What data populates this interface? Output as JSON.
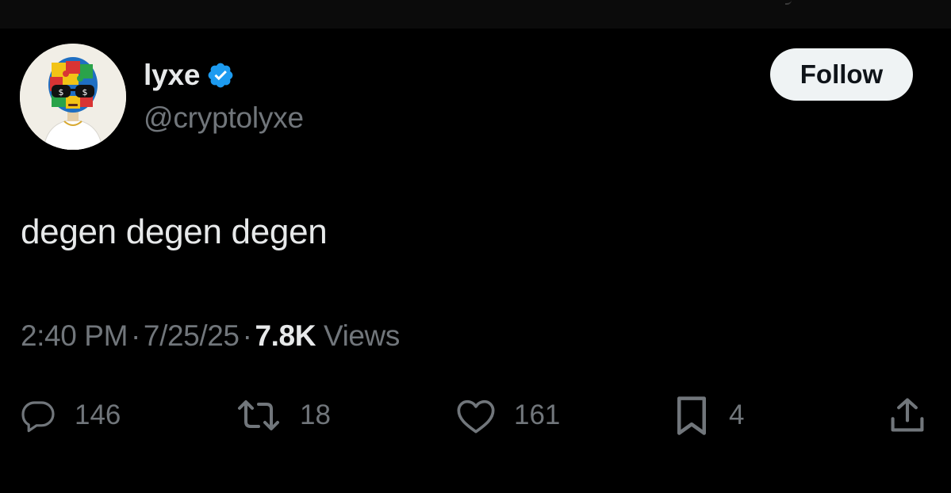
{
  "colors": {
    "background": "#000000",
    "primary_text": "#e7e9ea",
    "secondary_text": "#71767b",
    "verified_badge": "#1d9bf0",
    "follow_button_bg": "#eff3f4",
    "follow_button_text": "#0f1419"
  },
  "author": {
    "display_name": "lyxe",
    "handle": "@cryptolyxe",
    "verified": true,
    "verified_icon": "verified-badge-icon",
    "avatar_icon": "avatar"
  },
  "follow_button": {
    "label": "Follow"
  },
  "tweet": {
    "text": "degen degen degen"
  },
  "meta": {
    "time": "2:40 PM",
    "separator": "·",
    "date": "7/25/25",
    "views_count": "7.8K",
    "views_label": "Views"
  },
  "actions": {
    "reply": {
      "icon": "reply-icon",
      "count": "146"
    },
    "repost": {
      "icon": "repost-icon",
      "count": "18"
    },
    "like": {
      "icon": "heart-icon",
      "count": "161"
    },
    "bookmark": {
      "icon": "bookmark-icon",
      "count": "4"
    },
    "share": {
      "icon": "share-icon"
    }
  }
}
